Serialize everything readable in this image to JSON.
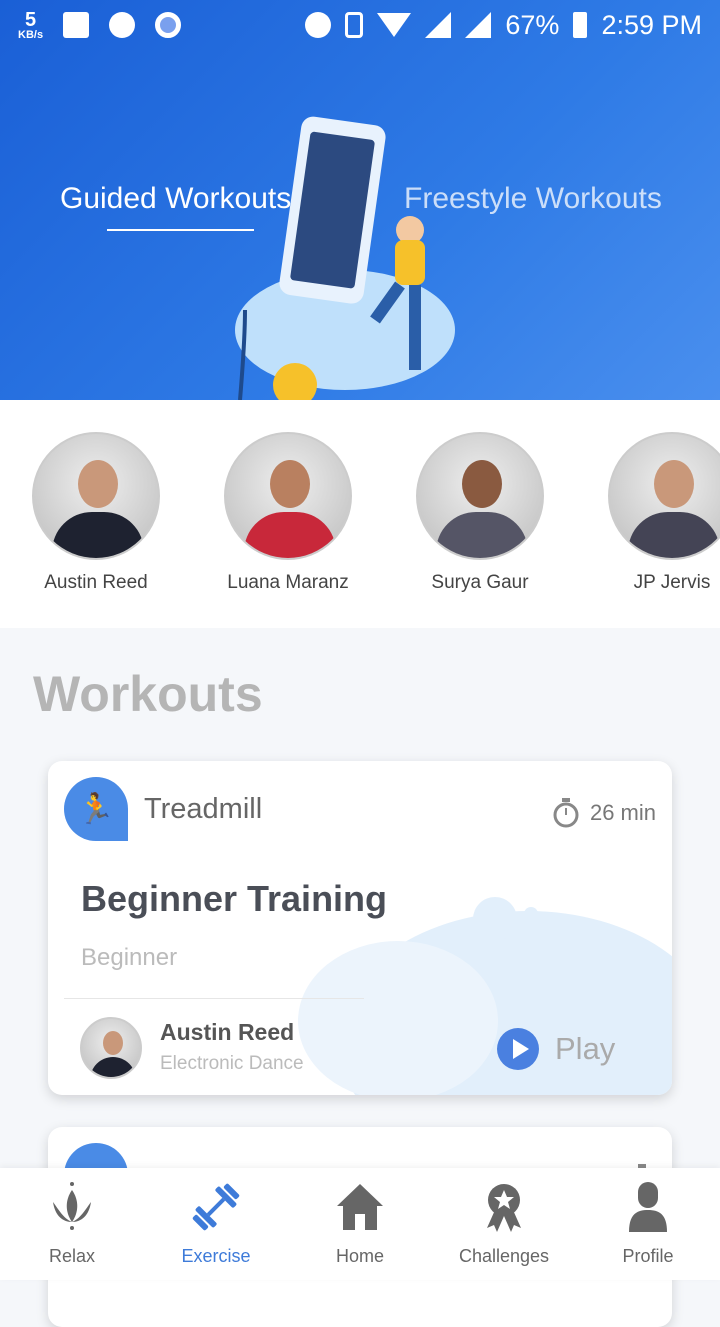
{
  "status_bar": {
    "net_speed": "5",
    "net_unit": "KB/s",
    "battery": "67%",
    "time": "2:59 PM"
  },
  "hero": {
    "tabs": [
      {
        "label": "Guided Workouts",
        "active": true
      },
      {
        "label": "Freestyle Workouts",
        "active": false
      }
    ]
  },
  "trainers": [
    {
      "name": "Austin Reed"
    },
    {
      "name": "Luana Maranz"
    },
    {
      "name": "Surya Gaur"
    },
    {
      "name": "JP Jervis"
    }
  ],
  "workouts": {
    "title": "Workouts",
    "cards": [
      {
        "category": "Treadmill",
        "duration": "26 min",
        "title": "Beginner Training",
        "level": "Beginner",
        "trainer": "Austin Reed",
        "genre": "Electronic Dance",
        "action": "Play"
      }
    ]
  },
  "nav": {
    "items": [
      {
        "label": "Relax",
        "icon": "lotus-icon"
      },
      {
        "label": "Exercise",
        "icon": "dumbbell-icon",
        "active": true
      },
      {
        "label": "Home",
        "icon": "home-icon"
      },
      {
        "label": "Challenges",
        "icon": "award-icon"
      },
      {
        "label": "Profile",
        "icon": "person-icon"
      }
    ]
  },
  "colors": {
    "accent": "#3e7bd9",
    "hero": "#1a5fd6"
  }
}
